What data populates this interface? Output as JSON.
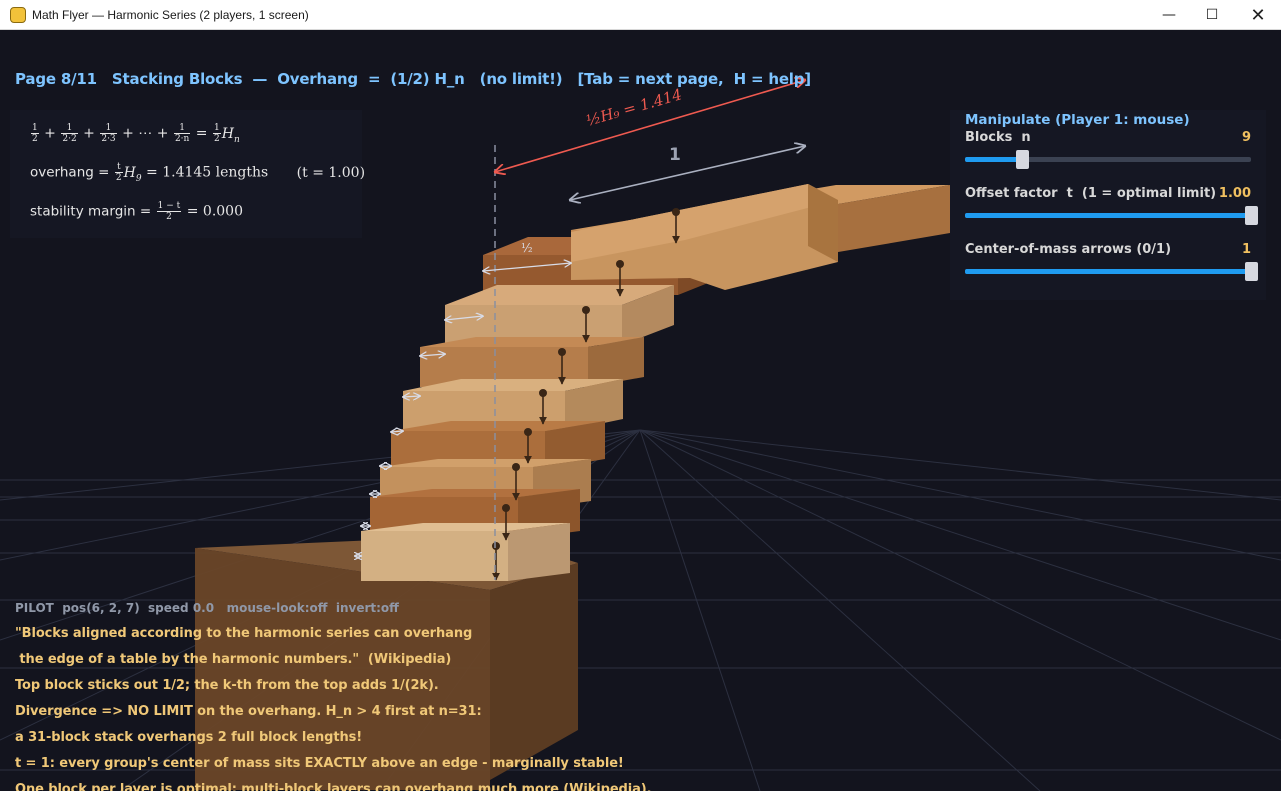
{
  "window": {
    "title": "Math Flyer — Harmonic Series (2 players, 1 screen)",
    "minimize_glyph": "—",
    "maximize_glyph": "☐",
    "close_glyph": "✕"
  },
  "header": {
    "text": "Page 8/11   Stacking Blocks  —  Overhang  =  (1/2) H_n   (no limit!)   [Tab = next page,  H = help]"
  },
  "formulas": {
    "series_tail": "+ ⋯ +",
    "series_equals": "=",
    "overhang_label": "overhang =",
    "overhang_value": "= 1.4145 lengths",
    "t_label": "(t = 1.00)",
    "stability_label": "stability margin =",
    "stability_value": "= 0.000"
  },
  "scene_labels": {
    "red_label": "½H₉ = 1.414",
    "gray_label": "1",
    "top_fraction": "½"
  },
  "controls": {
    "title": "Manipulate  (Player 1: mouse)",
    "sliders": [
      {
        "label": "Blocks  n",
        "value": "9",
        "fraction": 0.2
      },
      {
        "label": "Offset factor  t  (1 = optimal limit)",
        "value": "1.00",
        "fraction": 1.0
      },
      {
        "label": "Center-of-mass arrows (0/1)",
        "value": "1",
        "fraction": 1.0
      }
    ]
  },
  "pilot": {
    "text": "PILOT  pos(6, 2, 7)  speed 0.0   mouse-look:off  invert:off"
  },
  "info_lines": [
    "\"Blocks aligned according to the harmonic series can overhang",
    " the edge of a table by the harmonic numbers.\"  (Wikipedia)",
    "Top block sticks out 1/2; the k-th from the top adds 1/(2k).",
    "Divergence => NO LIMIT on the overhang. H_n > 4 first at n=31:",
    "a 31-block stack overhangs 2 full block lengths!",
    "t = 1: every group's center of mass sits EXACTLY above an edge - marginally stable!",
    "One block per layer is optimal; multi-block layers can overhang much more (Wikipedia)."
  ],
  "colors": {
    "background": "#13141e",
    "header_blue": "#7ec4ff",
    "info_yellow": "#f0c878",
    "red_arrow": "#ef5a50",
    "slider_fill": "#1f9bf0",
    "table_wood": "#7a5534"
  },
  "icons": [
    "app-icon",
    "minimize-icon",
    "maximize-icon",
    "close-icon"
  ]
}
